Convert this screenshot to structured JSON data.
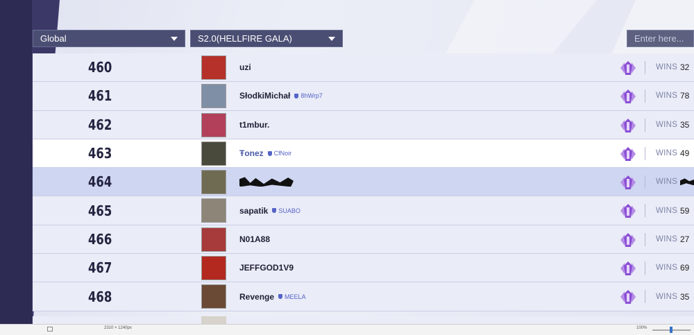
{
  "filters": {
    "region": "Global",
    "season": "S2.0(HELLFIRE GALA)"
  },
  "search": {
    "placeholder": "Enter here..."
  },
  "wins_label": "WINS",
  "rows": [
    {
      "rank": "460",
      "name": "uzi",
      "tag": "",
      "wins": "32",
      "avatar_color": "#b5312a"
    },
    {
      "rank": "461",
      "name": "SłodkiMichał",
      "tag": "8hWrp7",
      "wins": "78",
      "avatar_color": "#7f8fa6"
    },
    {
      "rank": "462",
      "name": "t1mbur.",
      "tag": "",
      "wins": "35",
      "avatar_color": "#b2405b"
    },
    {
      "rank": "463",
      "name": "Ŧonez",
      "tag": "CfNoir",
      "wins": "49",
      "avatar_color": "#4a4a3c",
      "highlight": true
    },
    {
      "rank": "464",
      "name": "",
      "tag": "",
      "wins": "",
      "avatar_color": "#6f6a52",
      "self": true
    },
    {
      "rank": "465",
      "name": "sapatik",
      "tag": "SUABO",
      "wins": "59",
      "avatar_color": "#8d8578"
    },
    {
      "rank": "466",
      "name": "N01A88",
      "tag": "",
      "wins": "27",
      "avatar_color": "#a73a3a"
    },
    {
      "rank": "467",
      "name": "JEFFGOD1V9",
      "tag": "",
      "wins": "69",
      "avatar_color": "#b3281f"
    },
    {
      "rank": "468",
      "name": "Revenge",
      "tag": "MEELA",
      "wins": "35",
      "avatar_color": "#6b4a35"
    }
  ],
  "rank_icon": "purple-rank-emblem-icon",
  "status_bar": {
    "dimensions": "2310 × 1240px",
    "zoom": "100%"
  }
}
